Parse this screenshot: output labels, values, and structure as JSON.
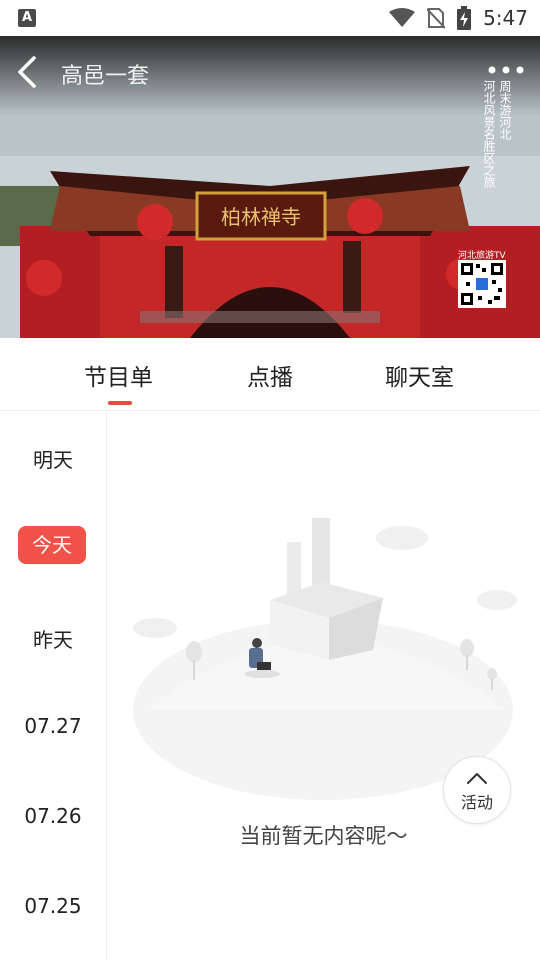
{
  "status_bar": {
    "time": "5:47",
    "left_icon": "A"
  },
  "player": {
    "title": "高邑一套",
    "overlay_right": "周末游河北",
    "overlay_left": "河北风景名胜区之旅",
    "sign_text": "柏林禅寺",
    "tv_label": "河北旅游TV"
  },
  "tabs": [
    {
      "label": "节目单",
      "active": true
    },
    {
      "label": "点播",
      "active": false
    },
    {
      "label": "聊天室",
      "active": false
    }
  ],
  "dates": [
    {
      "label": "明天",
      "selected": false
    },
    {
      "label": "今天",
      "selected": true
    },
    {
      "label": "昨天",
      "selected": false
    },
    {
      "label": "07.27",
      "selected": false
    },
    {
      "label": "07.26",
      "selected": false
    },
    {
      "label": "07.25",
      "selected": false
    }
  ],
  "empty_state": {
    "message": "当前暂无内容呢～"
  },
  "activity_button": {
    "label": "活动"
  },
  "colors": {
    "accent": "#e94a3d",
    "selected_bg": "#f0524a"
  }
}
